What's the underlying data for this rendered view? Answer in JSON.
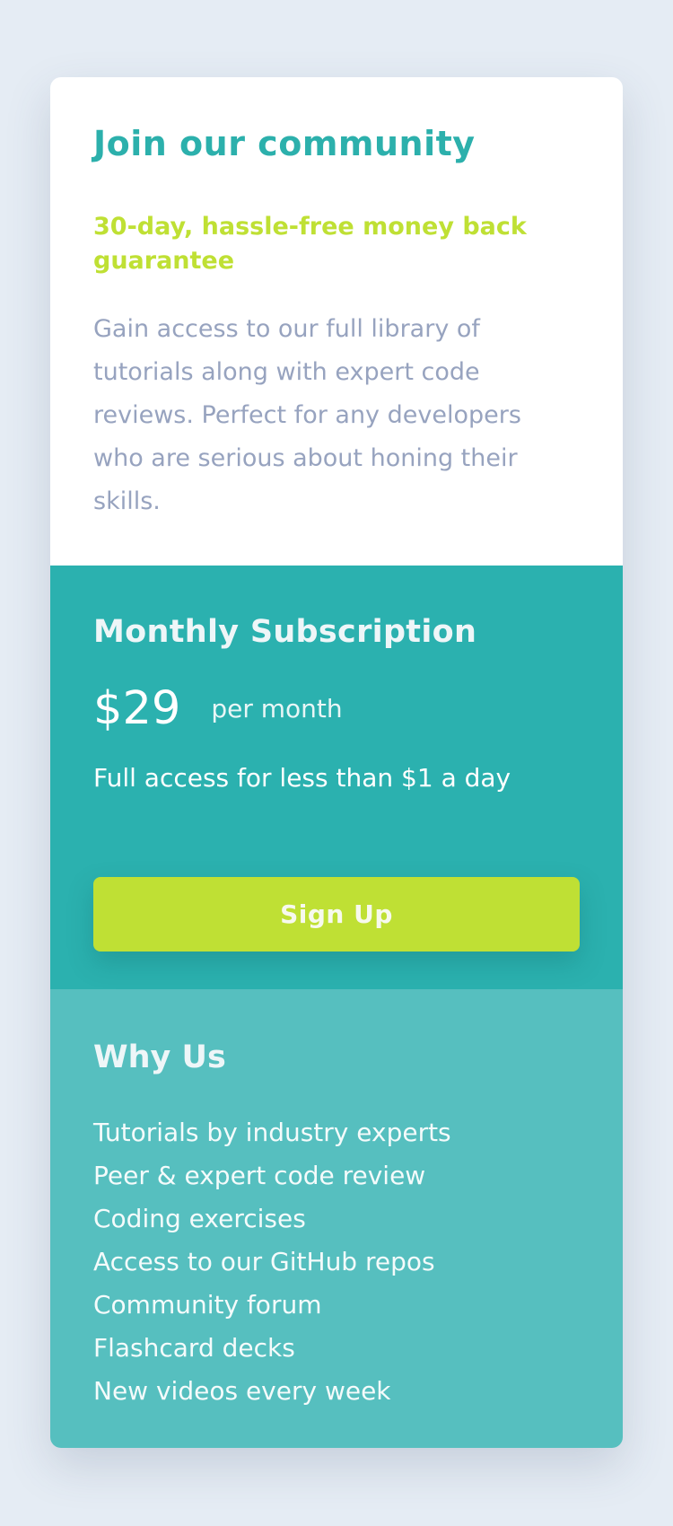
{
  "intro": {
    "title": "Join our community",
    "guarantee": "30-day, hassle-free money back guarantee",
    "description": "Gain access to our full library of tutorials along with expert code reviews. Perfect for any developers who are serious about honing their skills."
  },
  "subscription": {
    "title": "Monthly Subscription",
    "price": "$29",
    "period": "per month",
    "note": "Full access for less than $1 a day",
    "button_label": "Sign Up"
  },
  "why_us": {
    "title": "Why Us",
    "features": [
      "Tutorials by industry experts",
      "Peer & expert code review",
      "Coding exercises",
      "Access to our GitHub repos",
      "Community forum",
      "Flashcard decks",
      "New videos every week"
    ]
  },
  "colors": {
    "background": "#e5ecf4",
    "accent_teal": "#2bb1af",
    "light_teal": "#56bfbf",
    "lime": "#bfe034",
    "muted_text": "#97a3bf"
  }
}
